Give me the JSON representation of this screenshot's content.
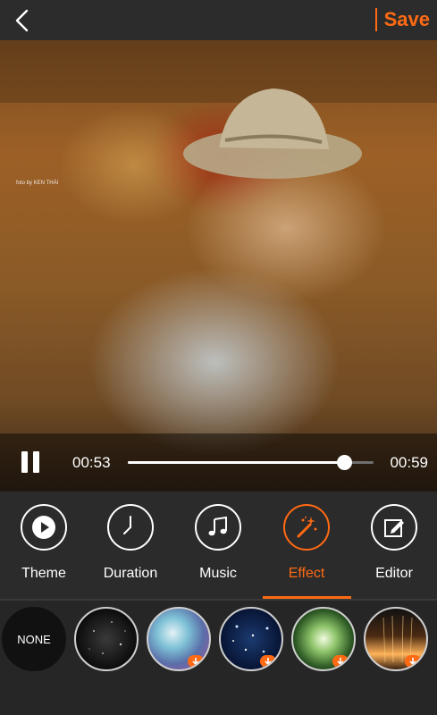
{
  "header": {
    "back_icon": "chevron-left-icon",
    "save_label": "Save",
    "accent_color": "#ff6a13"
  },
  "preview": {
    "watermark": "foto by KEN THÁI"
  },
  "player": {
    "current_time": "00:53",
    "total_time": "00:59",
    "progress_fraction": 0.88,
    "pause_icon": "pause-icon"
  },
  "toolbar": {
    "tabs": [
      {
        "label": "Theme",
        "icon": "play-circle-icon",
        "active": false
      },
      {
        "label": "Duration",
        "icon": "clock-icon",
        "active": false
      },
      {
        "label": "Music",
        "icon": "music-note-icon",
        "active": false
      },
      {
        "label": "Effect",
        "icon": "magic-wand-icon",
        "active": true
      },
      {
        "label": "Editor",
        "icon": "edit-icon",
        "active": false
      }
    ]
  },
  "effects": {
    "none_label": "NONE",
    "items": [
      {
        "name": "none"
      },
      {
        "name": "dark-particles",
        "download": false
      },
      {
        "name": "blue-swirl",
        "download": true
      },
      {
        "name": "starfield",
        "download": true
      },
      {
        "name": "green-glow",
        "download": true
      },
      {
        "name": "light-rays",
        "download": true
      }
    ]
  }
}
